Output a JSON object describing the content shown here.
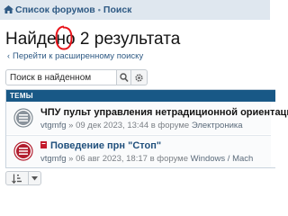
{
  "breadcrumbs": [
    "Список форумов",
    "Поиск"
  ],
  "page": {
    "title_prefix": "Найдено",
    "result_count": "2",
    "title_suffix": "результата"
  },
  "back_link": "Перейти к расширенному поиску",
  "search": {
    "placeholder": "Поиск в найденном"
  },
  "results": {
    "header": "ТЕМЫ",
    "items": [
      {
        "title": "ЧПУ пульт управления нетрадиционной ориентации",
        "author": "vtgmfg",
        "date": "09 дек 2023, 13:44",
        "forum_prefix": "в форуме",
        "forum": "Электроника"
      },
      {
        "title": "Поведение прн \"Стоп\"",
        "author": "vtgmfg",
        "date": "06 авг 2023, 18:17",
        "forum_prefix": "в форуме",
        "forum": "Windows / Mach"
      }
    ]
  },
  "colors": {
    "header_bg": "#185886",
    "link": "#2f5a84",
    "topbar": "#dfe7ef",
    "annotation": "#e8141b",
    "pin_red": "#c41a2b"
  }
}
